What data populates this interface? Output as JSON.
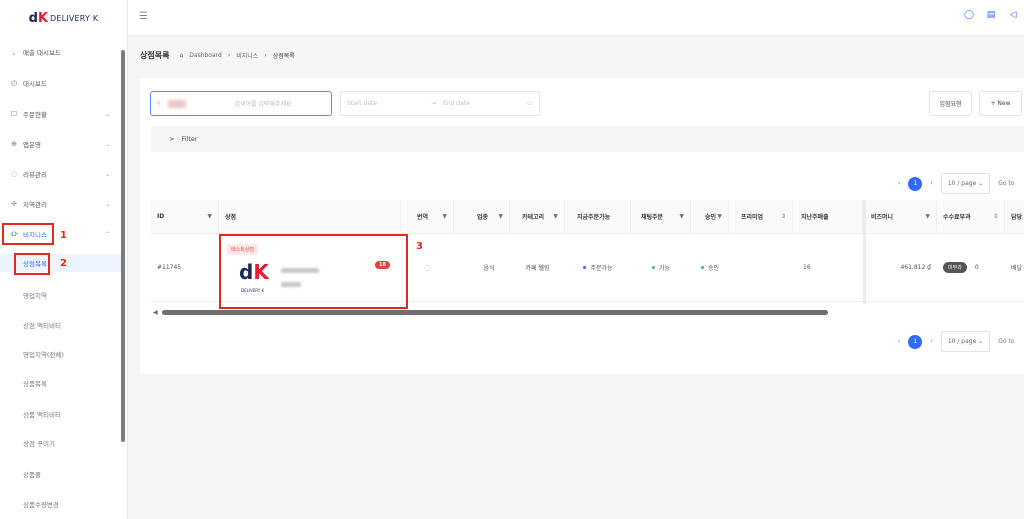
{
  "brand": {
    "mark_d": "d",
    "mark_k": "K",
    "text": "DELIVERY K"
  },
  "sidebar": {
    "items": [
      {
        "icon": "⌞",
        "icon_name": "chart-icon",
        "label": "매출 대시보드",
        "chev": ""
      },
      {
        "icon": "◴",
        "icon_name": "clock-icon",
        "label": "대시보드",
        "chev": ""
      },
      {
        "icon": "☐",
        "icon_name": "order-icon",
        "label": "주문현황",
        "chev": "⌄"
      },
      {
        "icon": "⊕",
        "icon_name": "app-icon",
        "label": "앱운영",
        "chev": "⌄"
      },
      {
        "icon": "◌",
        "icon_name": "review-icon",
        "label": "리뷰관리",
        "chev": "⌄"
      },
      {
        "icon": "✢",
        "icon_name": "region-icon",
        "label": "지역관리",
        "chev": "⌄"
      },
      {
        "icon": "⛮",
        "icon_name": "business-icon",
        "label": "비지니스",
        "chev": "⌃"
      }
    ],
    "subitems": [
      "상점목록",
      "영업지역",
      "상점 액티비티",
      "영업지역(전체)",
      "상품목록",
      "상품 액티비티",
      "상점 꾸미기",
      "상품풀",
      "상품수량변경"
    ]
  },
  "annotations": {
    "n1": "1",
    "n2": "2",
    "n3": "3"
  },
  "header": {
    "burger": "☰",
    "icons": [
      "◯",
      "▤",
      "◁"
    ]
  },
  "breadcrumb": {
    "title": "상점목록",
    "home": "⌂",
    "dashboard": "Dashboard",
    "sep": "›",
    "business": "비지니스",
    "current": "상점목록"
  },
  "toolbar": {
    "search_icon": "⚲",
    "search_placeholder": "검색어를 입력해주세요",
    "start_date": "Start date",
    "arrow": "→",
    "end_date": "End date",
    "calendar_icon": "▭",
    "request_label": "입점요청",
    "new_label": "+ New",
    "filter_chevron": ">",
    "filter_label": "Filter"
  },
  "pagination": {
    "prev": "‹",
    "page": "1",
    "next": "›",
    "size": "10 / page ⌄",
    "goto": "Go to"
  },
  "table": {
    "headers": [
      "ID",
      "상점",
      "번역",
      "업종",
      "카테고리",
      "지금주문가능",
      "채팅주문",
      "승인",
      "프리미엄",
      "지난주매출",
      "비즈머니",
      "수수료부과",
      "담당"
    ],
    "filter_icon": "▼",
    "sort_icon": "⇕",
    "row": {
      "id": "#11745",
      "store_tag": "테스트상점",
      "translation_count": "18",
      "industry": "음식",
      "category": "카페 웰빙",
      "order_available": "주문가능",
      "chat_order": "가능",
      "approval": "승인",
      "premium": "",
      "last_week_sales": "16",
      "biz_money": "461,812 ₫",
      "fee_status": "미부과",
      "fee_value": "0",
      "manager": "배달"
    }
  },
  "colors": {
    "accent": "#2f6bff",
    "annotation": "#e02a1e",
    "brand_navy": "#1c2a5b",
    "brand_red": "#e21e2f"
  }
}
